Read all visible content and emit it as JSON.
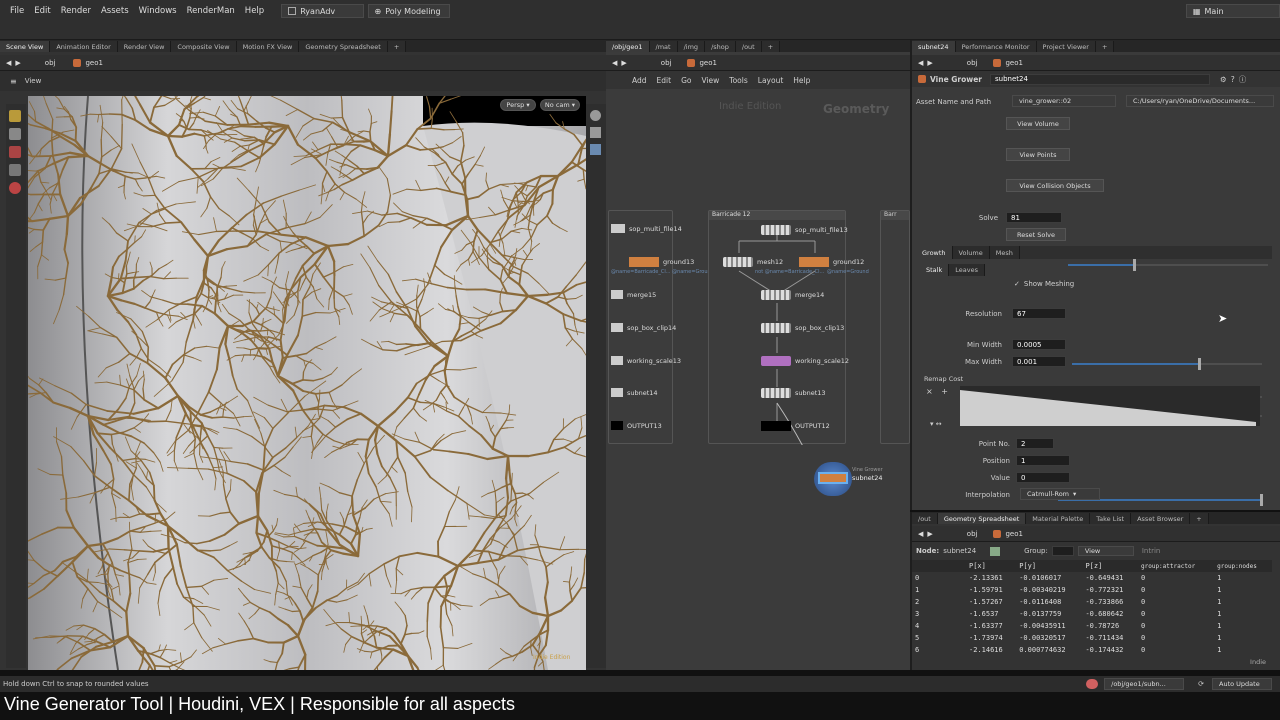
{
  "menubar": {
    "items": [
      "File",
      "Edit",
      "Render",
      "Assets",
      "Windows",
      "RenderMan",
      "Help"
    ],
    "shelf_set": "RyanAdv",
    "desktop": "Poly Modeling",
    "main_label": "Main"
  },
  "left_pane": {
    "tabs": [
      "Scene View",
      "Animation Editor",
      "Render View",
      "Composite View",
      "Motion FX View",
      "Geometry Spreadsheet"
    ],
    "path": [
      "obj",
      "geo1"
    ],
    "view_label": "View",
    "persp": "Persp",
    "cam": "No cam",
    "watermark": "Indie Edition"
  },
  "network_pane": {
    "tabs": [
      "/obj/geo1",
      "/mat",
      "/img",
      "/shop",
      "/out"
    ],
    "path": [
      "obj",
      "geo1"
    ],
    "menu": [
      "Add",
      "Edit",
      "Go",
      "View",
      "Tools",
      "Layout",
      "Help"
    ],
    "watermark": "Indie Edition",
    "context_label": "Geometry",
    "left_box_nodes": [
      "sop_multi_file14",
      "ground13",
      "merge15",
      "sop_box_clip14",
      "working_scale13",
      "subnet14",
      "OUTPUT13"
    ],
    "box_title": "Barricade 12",
    "right_box_title": "Barr",
    "center_nodes": [
      "sop_multi_file13",
      "mesh12",
      "ground12",
      "merge14",
      "sop_box_clip13",
      "working_scale12",
      "subnet13",
      "OUTPUT12"
    ],
    "mesh_sub": "not @name=Barricade_Cl...",
    "ground_sub": "@name=Ground",
    "left_sub": "@name=Barricade_Cl... @name=Ground",
    "vine_node": "subnet24",
    "vine_node_sub": "Vine Grower"
  },
  "params_pane": {
    "tabs": [
      "subnet24",
      "Performance Monitor",
      "Project Viewer"
    ],
    "path": [
      "obj",
      "geo1"
    ],
    "node_type": "Vine Grower",
    "node_name": "subnet24",
    "asset_label": "Asset Name and Path",
    "asset_name": "vine_grower::02",
    "asset_path": "C:/Users/ryan/OneDrive/Documents...",
    "buttons": [
      "View Volume",
      "View Points",
      "View Collision Objects"
    ],
    "solve_label": "Solve",
    "solve_value": "81",
    "solve_fraction": 0.33,
    "reset_label": "Reset Solve",
    "main_tabs": [
      "Growth",
      "Volume",
      "Mesh"
    ],
    "sub_tabs": [
      "Stalk",
      "Leaves"
    ],
    "show_meshing": "Show Meshing",
    "resolution_label": "Resolution",
    "resolution_value": "67",
    "resolution_fraction": 0.67,
    "min_width_label": "Min Width",
    "min_width_value": "0.0005",
    "max_width_label": "Max Width",
    "max_width_value": "0.001",
    "remap_label": "Remap Cost",
    "point_no_label": "Point No.",
    "point_no_value": "2",
    "position_label": "Position",
    "position_value": "1",
    "value_label": "Value",
    "value_value": "0",
    "interp_label": "Interpolation",
    "interp_value": "Catmull-Rom"
  },
  "spreadsheet": {
    "tabs": [
      "/out",
      "Geometry Spreadsheet",
      "Material Palette",
      "Take List",
      "Asset Browser"
    ],
    "path": [
      "obj",
      "geo1"
    ],
    "node_label": "Node:",
    "node_value": "subnet24",
    "group_label": "Group:",
    "view_label": "View",
    "intrinsic_label": "Intrin",
    "columns": [
      "",
      "P[x]",
      "P[y]",
      "P[z]",
      "group:attractor",
      "group:nodes"
    ],
    "rows": [
      [
        "0",
        "-2.13361",
        "-0.0106017",
        "-0.649431",
        "0",
        "1"
      ],
      [
        "1",
        "-1.59791",
        "-0.00340219",
        "-0.772321",
        "0",
        "1"
      ],
      [
        "2",
        "-1.57267",
        "-0.0116408",
        "-0.733866",
        "0",
        "1"
      ],
      [
        "3",
        "-1.6537",
        "-0.0137759",
        "-0.680642",
        "0",
        "1"
      ],
      [
        "4",
        "-1.63377",
        "-0.00435911",
        "-0.78726",
        "0",
        "1"
      ],
      [
        "5",
        "-1.73974",
        "-0.00320517",
        "-0.711434",
        "0",
        "1"
      ],
      [
        "6",
        "-2.14616",
        "0.000774632",
        "-0.174432",
        "0",
        "1"
      ]
    ],
    "indie_tag": "Indie"
  },
  "statusbar": {
    "message": "Hold down Ctrl to snap to rounded values",
    "path": "/obj/geo1/subn...",
    "update_mode": "Auto Update"
  },
  "caption": "Vine Generator Tool | Houdini, VEX | Responsible for all aspects",
  "colors": {
    "accent": "#3a6ea8",
    "vine": "#8a6a3a",
    "panel": "#3a3a3a"
  }
}
